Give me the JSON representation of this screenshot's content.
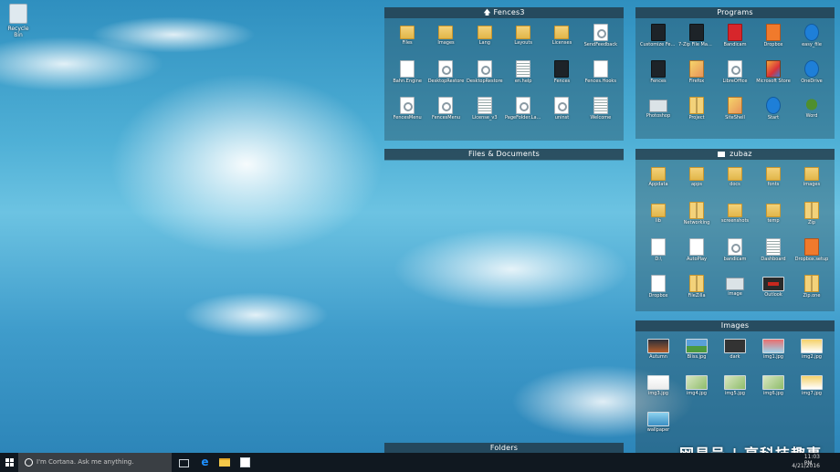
{
  "desktop": {
    "recycle_bin_label": "Recycle Bin"
  },
  "fences": {
    "fences3": {
      "title": "Fences3",
      "items": [
        {
          "label": "Files",
          "icon": "folder-icon"
        },
        {
          "label": "Images",
          "icon": "folder-icon"
        },
        {
          "label": "Lang",
          "icon": "folder-icon"
        },
        {
          "label": "Layouts",
          "icon": "folder-icon"
        },
        {
          "label": "Licenses",
          "icon": "folder-icon"
        },
        {
          "label": "SendFeedback",
          "icon": "settings-file-icon"
        },
        {
          "label": "Bahn.Engine",
          "icon": "file-icon"
        },
        {
          "label": "DesktopRestore",
          "icon": "settings-file-icon"
        },
        {
          "label": "DesktopRestore",
          "icon": "settings-file-icon"
        },
        {
          "label": "en.help",
          "icon": "text-file-icon"
        },
        {
          "label": "Fences",
          "icon": "app-icon"
        },
        {
          "label": "Fences.Hooks",
          "icon": "file-icon"
        },
        {
          "label": "FencesMenu",
          "icon": "settings-file-icon"
        },
        {
          "label": "FencesMenu",
          "icon": "settings-file-icon"
        },
        {
          "label": "License_v3",
          "icon": "text-file-icon"
        },
        {
          "label": "PageFolder.Layout",
          "icon": "settings-file-icon"
        },
        {
          "label": "uninst",
          "icon": "settings-file-icon"
        },
        {
          "label": "Welcome",
          "icon": "text-file-icon"
        }
      ]
    },
    "files_documents": {
      "title": "Files & Documents"
    },
    "programs": {
      "title": "Programs",
      "items": [
        {
          "label": "Customize Fences",
          "icon": "app-icon"
        },
        {
          "label": "7-Zip File Manager",
          "icon": "7zip-icon"
        },
        {
          "label": "Bandicam",
          "icon": "bandicam-icon"
        },
        {
          "label": "Dropbox",
          "icon": "dropbox-icon"
        },
        {
          "label": "easy_file",
          "icon": "browser-icon"
        },
        {
          "label": "Fences",
          "icon": "app-icon"
        },
        {
          "label": "Firefox",
          "icon": "firefox-icon"
        },
        {
          "label": "LibreOffice",
          "icon": "office-icon"
        },
        {
          "label": "Microsoft Store",
          "icon": "cube-icon"
        },
        {
          "label": "OneDrive",
          "icon": "onedrive-icon"
        },
        {
          "label": "Photoshop",
          "icon": "monitor-icon"
        },
        {
          "label": "Project",
          "icon": "zip-icon"
        },
        {
          "label": "SiteShell",
          "icon": "package-icon"
        },
        {
          "label": "Start",
          "icon": "browser-icon"
        },
        {
          "label": "Word",
          "icon": "tree-icon"
        }
      ]
    },
    "zubaz": {
      "title": "zubaz",
      "items": [
        {
          "label": "Appdata",
          "icon": "folder-icon"
        },
        {
          "label": "apps",
          "icon": "folder-icon"
        },
        {
          "label": "docs",
          "icon": "folder-icon"
        },
        {
          "label": "fonts",
          "icon": "folder-icon"
        },
        {
          "label": "images",
          "icon": "folder-icon"
        },
        {
          "label": "lib",
          "icon": "folder-icon"
        },
        {
          "label": "Networking",
          "icon": "zip-icon"
        },
        {
          "label": "screenshots",
          "icon": "folder-icon"
        },
        {
          "label": "temp",
          "icon": "folder-icon"
        },
        {
          "label": "Zip",
          "icon": "zip-icon"
        },
        {
          "label": "D:\\",
          "icon": "file-icon"
        },
        {
          "label": "AutoPlay",
          "icon": "file-icon"
        },
        {
          "label": "bandicam",
          "icon": "image-file-icon"
        },
        {
          "label": "Dashboard",
          "icon": "text-file-icon"
        },
        {
          "label": "Dropbox.setup",
          "icon": "dropbox-icon"
        },
        {
          "label": "Dropbox",
          "icon": "file-icon"
        },
        {
          "label": "FileZilla",
          "icon": "zip-icon"
        },
        {
          "label": "image",
          "icon": "monitor-icon"
        },
        {
          "label": "Outlook",
          "icon": "dark-image-icon"
        },
        {
          "label": "Zip.one",
          "icon": "zip-icon"
        }
      ]
    },
    "images": {
      "title": "Images",
      "items": [
        {
          "label": "Autumn",
          "icon": "image-thumb-icon",
          "thumb": "img2"
        },
        {
          "label": "Bliss.jpg",
          "icon": "image-thumb-icon",
          "thumb": "img"
        },
        {
          "label": "dark",
          "icon": "image-thumb-icon",
          "thumb": "img3"
        },
        {
          "label": "img1.jpg",
          "icon": "image-thumb-icon",
          "thumb": "img5"
        },
        {
          "label": "img2.jpg",
          "icon": "image-thumb-icon",
          "thumb": "img6"
        },
        {
          "label": "img3.jpg",
          "icon": "image-thumb-icon",
          "thumb": "img7"
        },
        {
          "label": "img4.jpg",
          "icon": "image-thumb-icon",
          "thumb": "img4"
        },
        {
          "label": "img5.jpg",
          "icon": "image-thumb-icon",
          "thumb": "img4"
        },
        {
          "label": "img6.jpg",
          "icon": "image-thumb-icon",
          "thumb": "img4"
        },
        {
          "label": "img7.jpg",
          "icon": "image-thumb-icon",
          "thumb": "img6"
        },
        {
          "label": "wallpaper",
          "icon": "image-thumb-icon",
          "thumb": "img8"
        }
      ]
    },
    "folders": {
      "title": "Folders"
    }
  },
  "taskbar": {
    "search_placeholder": "I'm Cortana. Ask me anything.",
    "clock_time": "11:03 PM",
    "clock_date": "4/21/2016"
  },
  "watermark": "网易号 | 享科技趣事"
}
